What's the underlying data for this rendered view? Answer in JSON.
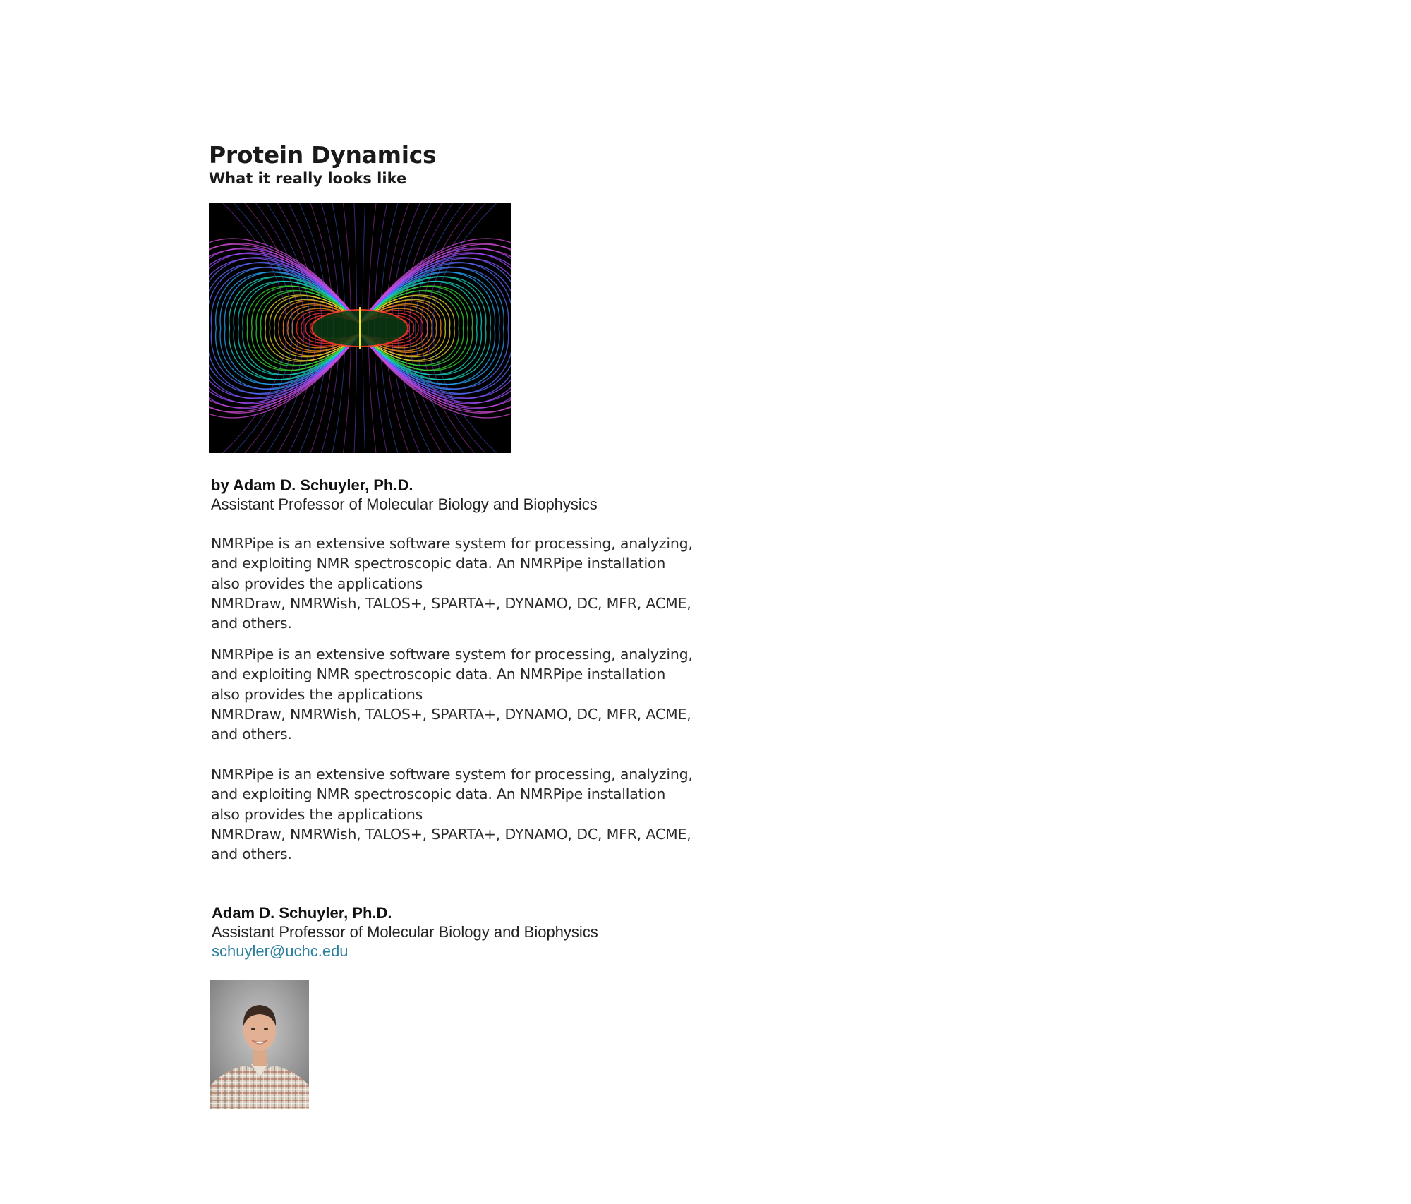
{
  "header": {
    "title": "Protein Dynamics",
    "subtitle": "What it really looks like"
  },
  "hero_image": {
    "icon": "magnetic-field-lines-image",
    "colors": [
      "#7b3cff",
      "#2aa7ff",
      "#18e0c8",
      "#39e03a",
      "#f0e62a",
      "#ff3b2a"
    ]
  },
  "byline": {
    "author": "by Adam D. Schuyler, Ph.D.",
    "role": "Assistant Professor of Molecular Biology and Biophysics"
  },
  "paragraphs": [
    {
      "lines": [
        "NMRPipe is an extensive software system for processing, analyzing,",
        "and exploiting NMR spectroscopic data. An NMRPipe installation",
        "also provides the applications",
        "NMRDraw, NMRWish, TALOS+, SPARTA+, DYNAMO, DC, MFR, ACME,",
        "and others."
      ]
    },
    {
      "lines": [
        "NMRPipe is an extensive software system for processing, analyzing,",
        "and exploiting NMR spectroscopic data. An NMRPipe installation",
        "also provides the applications",
        "NMRDraw, NMRWish, TALOS+, SPARTA+, DYNAMO, DC, MFR, ACME,",
        "and others."
      ]
    },
    {
      "lines": [
        "NMRPipe is an extensive software system for processing, analyzing,",
        "and exploiting NMR spectroscopic data. An NMRPipe installation",
        "also provides the applications",
        "NMRDraw, NMRWish, TALOS+, SPARTA+, DYNAMO, DC, MFR, ACME,",
        "and others."
      ]
    }
  ],
  "author_card": {
    "name": "Adam D. Schuyler, Ph.D.",
    "role": "Assistant Professor of Molecular Biology and Biophysics",
    "email": "schuyler@uchc.edu",
    "email_color": "#2a7f9e",
    "photo_icon": "author-portrait-photo"
  }
}
